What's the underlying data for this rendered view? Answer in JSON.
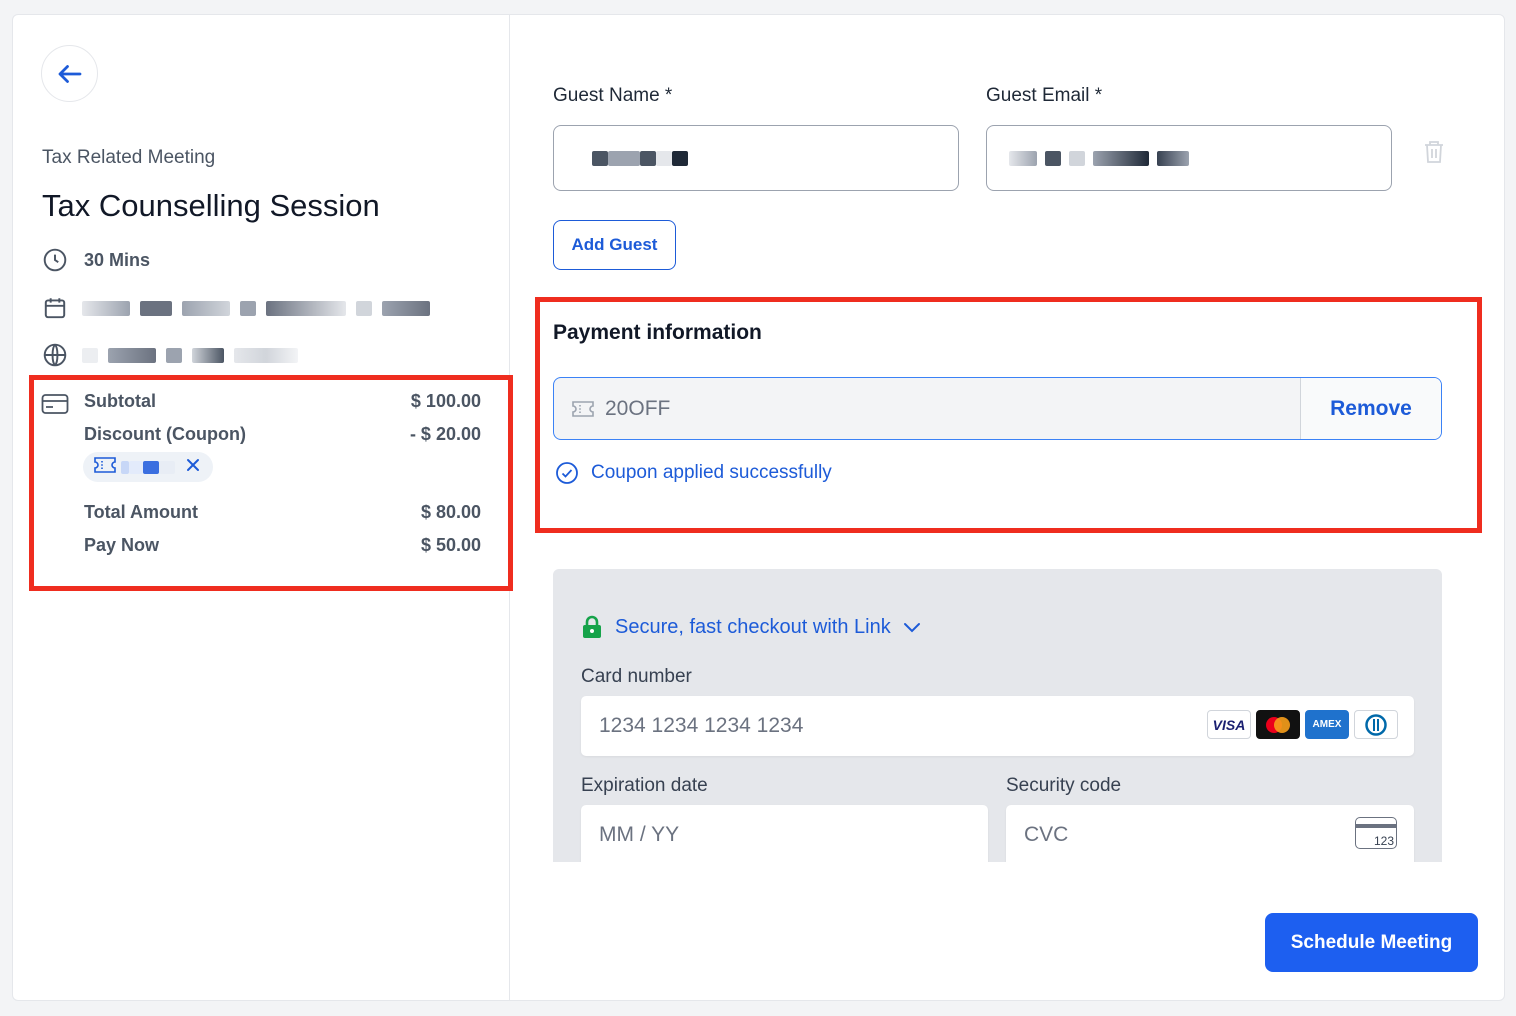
{
  "event": {
    "type_label": "Tax Related Meeting",
    "title": "Tax Counselling Session",
    "duration": "30 Mins"
  },
  "summary": {
    "subtotal_label": "Subtotal",
    "subtotal_value": "$ 100.00",
    "discount_label": "Discount (Coupon)",
    "discount_value": "- $ 20.00",
    "total_label": "Total Amount",
    "total_value": "$ 80.00",
    "pay_now_label": "Pay Now",
    "pay_now_value": "$ 50.00"
  },
  "form": {
    "guest_name_label": "Guest Name *",
    "guest_email_label": "Guest Email *",
    "add_guest_label": "Add Guest"
  },
  "payment": {
    "title": "Payment information",
    "coupon_code": "20OFF",
    "remove_label": "Remove",
    "success_message": "Coupon applied successfully"
  },
  "stripe": {
    "link_label": "Secure, fast checkout with Link",
    "card_number_label": "Card number",
    "card_number_placeholder": "1234 1234 1234 1234",
    "expiry_label": "Expiration date",
    "expiry_placeholder": "MM / YY",
    "cvc_label": "Security code",
    "cvc_placeholder": "CVC",
    "brands": [
      "VISA",
      "AMEX"
    ],
    "cvc_icon_text": "123"
  },
  "actions": {
    "schedule_label": "Schedule Meeting"
  },
  "colors": {
    "primary": "#1d5bd8",
    "highlight": "#ef2d1f",
    "link_lock": "#16a34a"
  }
}
